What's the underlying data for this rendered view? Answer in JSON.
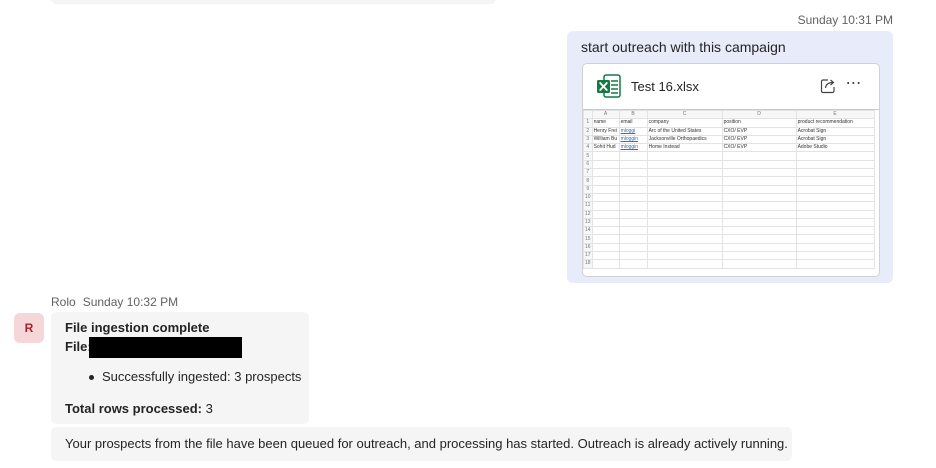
{
  "sent_message": {
    "timestamp": "Sunday 10:31 PM",
    "text": "start outreach with this campaign",
    "attachment": {
      "file_name": "Test 16.xlsx",
      "icon": "excel-icon",
      "actions": [
        "share-icon",
        "more-options-icon"
      ],
      "preview": {
        "columns": [
          "A",
          "B",
          "C",
          "D",
          "E"
        ],
        "rows": [
          [
            "name",
            "email",
            "company",
            "position",
            "product recommendation"
          ],
          [
            "Henry Frei",
            "mloggi",
            "Arc of the United States",
            "CXO/ EVP",
            "Acrobat Sign"
          ],
          [
            "William Bu",
            "mloggin",
            "Jacksonville Orthopaedics",
            "CXO/ EVP",
            "Acrobat Sign"
          ],
          [
            "Sohit Hud",
            "mloggin",
            "Home Instead",
            "CXO/ EVP",
            "Adobe Studio"
          ]
        ],
        "row_numbers": [
          "1",
          "2",
          "3",
          "4",
          "5",
          "6",
          "7",
          "8",
          "9",
          "10",
          "11",
          "12",
          "13",
          "14",
          "15",
          "16",
          "17",
          "18"
        ]
      }
    }
  },
  "bot_message": {
    "sender": "Rolo",
    "timestamp": "Sunday 10:32 PM",
    "avatar_initial": "R",
    "title": "File ingestion complete",
    "file_label": "File:",
    "bullet": "Successfully ingested: 3 prospects",
    "total_label": "Total rows processed:",
    "total_value": "3"
  },
  "bot_message_2": {
    "text": "Your prospects from the file have been queued for outreach, and processing has started. Outreach is already actively running."
  },
  "colors": {
    "sent_bubble": "#e8ebfa",
    "received_bubble": "#f5f5f5",
    "avatar_bg": "#f5d7d9",
    "avatar_fg": "#a4262c",
    "excel_green": "#107c41"
  }
}
